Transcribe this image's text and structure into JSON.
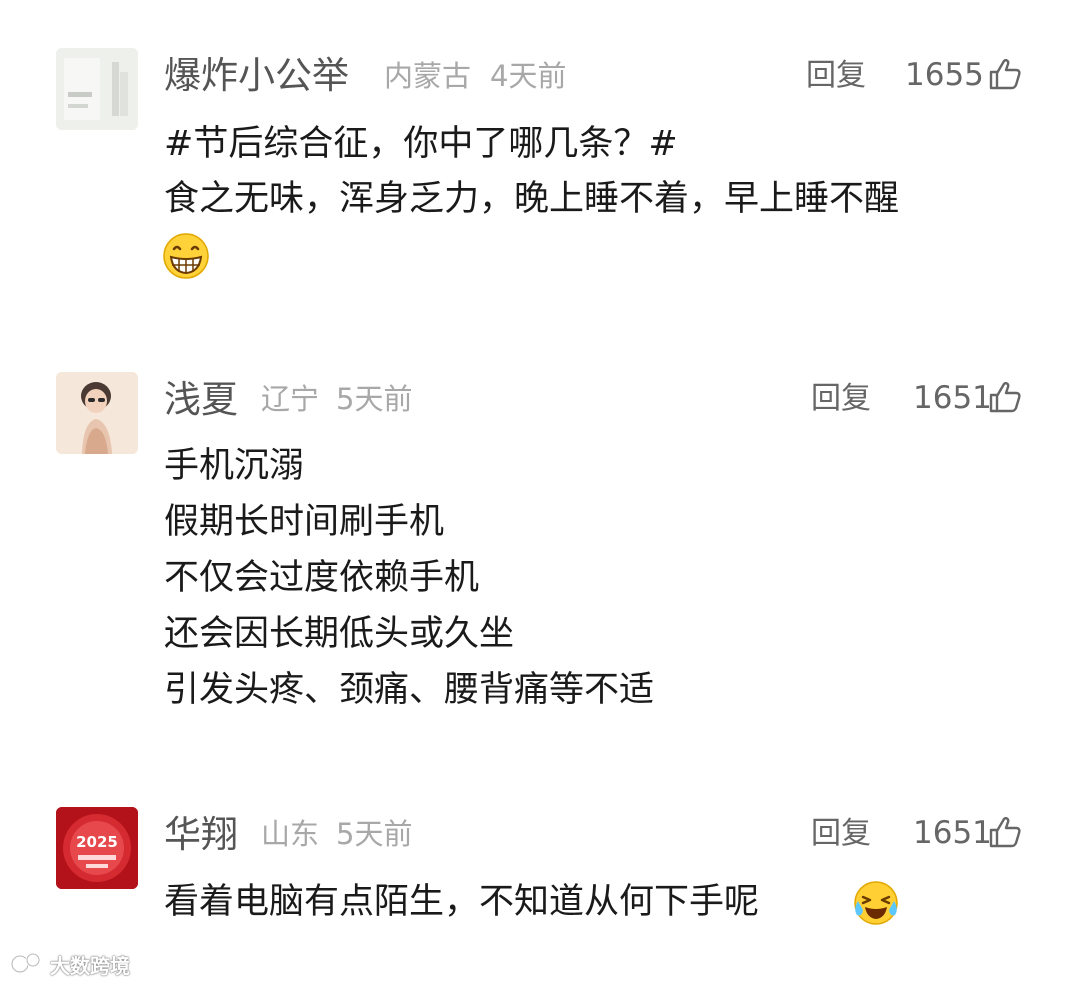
{
  "comments": [
    {
      "author": "爆炸小公举",
      "location": "内蒙古",
      "time": "4天前",
      "reply_label": "回复",
      "likes": "1655",
      "avatar_icon": "minimal-book-cover-avatar",
      "lines": [
        "#节后综合征，你中了哪几条？#",
        "食之无味，浑身乏力，晚上睡不着，早上睡不醒"
      ],
      "emoji": "grinning-face-emoji"
    },
    {
      "author": "浅夏",
      "location": "辽宁",
      "time": "5天前",
      "reply_label": "回复",
      "likes": "1651",
      "avatar_icon": "illustrated-girl-avatar",
      "lines": [
        "手机沉溺",
        "假期长时间刷手机",
        "不仅会过度依赖手机",
        "还会因长期低头或久坐",
        "引发头疼、颈痛、腰背痛等不适"
      ]
    },
    {
      "author": "华翔",
      "location": "山东",
      "time": "5天前",
      "reply_label": "回复",
      "likes": "1651",
      "avatar_icon": "red-2025-badge-avatar",
      "avatar_text": "2025",
      "lines": [
        "看着电脑有点陌生，不知道从何下手呢"
      ],
      "emoji": "laughing-crying-emoji"
    }
  ],
  "watermark": {
    "text": "大数跨境",
    "icon": "watermark-logo-icon"
  },
  "colors": {
    "name": "#555555",
    "meta": "#a8a8a8",
    "body": "#1a1a1a",
    "background": "#ffffff"
  }
}
